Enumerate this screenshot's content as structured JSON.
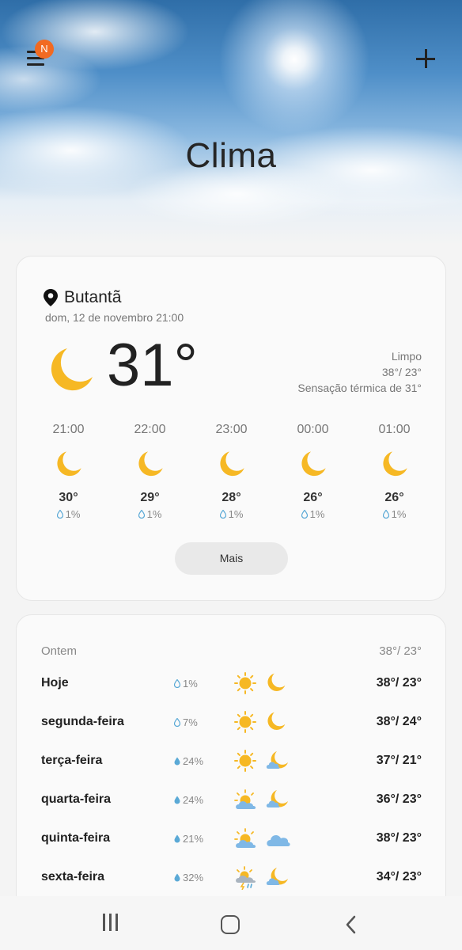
{
  "header": {
    "title": "Clima",
    "notification_badge": "N",
    "menu_icon": "hamburger-menu-icon",
    "add_icon": "plus-icon"
  },
  "current": {
    "location": "Butantã",
    "datetime": "dom, 12 de novembro 21:00",
    "temperature": "31°",
    "condition": "Limpo",
    "high_low": "38°/ 23°",
    "feels_like": "Sensação térmica de 31°",
    "icon": "moon-icon"
  },
  "hourly": [
    {
      "time": "21:00",
      "temp": "30°",
      "precip": "1%",
      "icon": "moon-icon"
    },
    {
      "time": "22:00",
      "temp": "29°",
      "precip": "1%",
      "icon": "moon-icon"
    },
    {
      "time": "23:00",
      "temp": "28°",
      "precip": "1%",
      "icon": "moon-icon"
    },
    {
      "time": "00:00",
      "temp": "26°",
      "precip": "1%",
      "icon": "moon-icon"
    },
    {
      "time": "01:00",
      "temp": "26°",
      "precip": "1%",
      "icon": "moon-icon"
    }
  ],
  "more_button": "Mais",
  "yesterday": {
    "label": "Ontem",
    "temps": "38°/ 23°"
  },
  "daily": [
    {
      "day": "Hoje",
      "precip": "1%",
      "day_icon": "sun-icon",
      "night_icon": "moon-icon",
      "temps": "38°/ 23°"
    },
    {
      "day": "segunda-feira",
      "precip": "7%",
      "day_icon": "sun-icon",
      "night_icon": "moon-icon",
      "temps": "38°/ 24°"
    },
    {
      "day": "terça-feira",
      "precip": "24%",
      "day_icon": "sun-icon",
      "night_icon": "moon-cloud-icon",
      "temps": "37°/ 21°"
    },
    {
      "day": "quarta-feira",
      "precip": "24%",
      "day_icon": "sun-cloud-icon",
      "night_icon": "moon-cloud-icon",
      "temps": "36°/ 23°"
    },
    {
      "day": "quinta-feira",
      "precip": "21%",
      "day_icon": "sun-cloud-icon",
      "night_icon": "cloud-icon",
      "temps": "38°/ 23°"
    },
    {
      "day": "sexta-feira",
      "precip": "32%",
      "day_icon": "sun-storm-icon",
      "night_icon": "moon-cloud-icon",
      "temps": "34°/ 23°"
    }
  ],
  "colors": {
    "moon": "#f6b824",
    "sun": "#f6b824",
    "cloud": "#7fb8e6",
    "badge": "#f26a21",
    "drop": "#5aa9d6"
  },
  "navbar": {
    "recents_icon": "recent-apps-icon",
    "home_icon": "home-icon",
    "back_icon": "back-arrow-icon"
  }
}
